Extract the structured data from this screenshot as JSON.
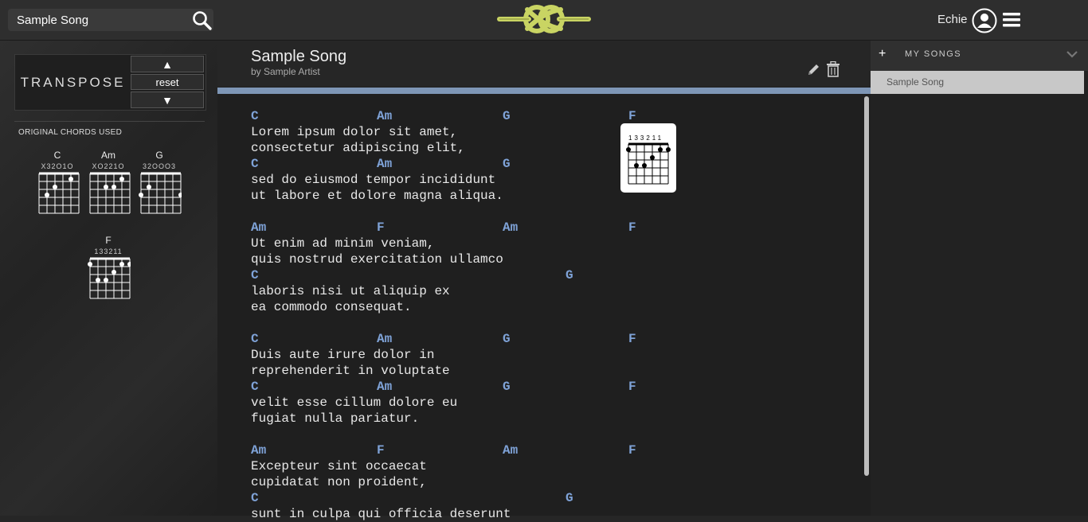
{
  "header": {
    "search_value": "Sample Song",
    "username": "Echie"
  },
  "transpose": {
    "label": "TRANSPOSE",
    "up": "▲",
    "reset": "reset",
    "down": "▼"
  },
  "original_chords": {
    "label": "ORIGINAL CHORDS USED",
    "chords": [
      {
        "name": "C",
        "fingering": "X32O1O"
      },
      {
        "name": "Am",
        "fingering": "XO221O"
      },
      {
        "name": "G",
        "fingering": "32OOO3"
      },
      {
        "name": "F",
        "fingering": "133211"
      }
    ]
  },
  "song": {
    "title": "Sample Song",
    "artist": "by Sample Artist",
    "popup_fingering": "133211",
    "lines": [
      {
        "chords": [
          {
            "c": "C",
            "p": 0
          },
          {
            "c": "Am",
            "p": 16
          },
          {
            "c": "G",
            "p": 32
          },
          {
            "c": "F",
            "p": 48
          }
        ]
      },
      {
        "lyric": "Lorem ipsum dolor sit amet,"
      },
      {
        "lyric": "consectetur adipiscing elit,"
      },
      {
        "chords": [
          {
            "c": "C",
            "p": 0
          },
          {
            "c": "Am",
            "p": 16
          },
          {
            "c": "G",
            "p": 32
          }
        ]
      },
      {
        "lyric": "sed do eiusmod tempor incididunt"
      },
      {
        "lyric": "ut labore et dolore magna aliqua."
      },
      {
        "gap": true
      },
      {
        "chords": [
          {
            "c": "Am",
            "p": 0
          },
          {
            "c": "F",
            "p": 16
          },
          {
            "c": "Am",
            "p": 32
          },
          {
            "c": "F",
            "p": 48
          }
        ]
      },
      {
        "lyric": "Ut enim ad minim veniam,"
      },
      {
        "lyric": "quis nostrud exercitation ullamco"
      },
      {
        "chords": [
          {
            "c": "C",
            "p": 0
          },
          {
            "c": "G",
            "p": 40
          }
        ]
      },
      {
        "lyric": "laboris nisi ut aliquip ex"
      },
      {
        "lyric": "ea commodo consequat."
      },
      {
        "gap": true
      },
      {
        "chords": [
          {
            "c": "C",
            "p": 0
          },
          {
            "c": "Am",
            "p": 16
          },
          {
            "c": "G",
            "p": 32
          },
          {
            "c": "F",
            "p": 48
          }
        ]
      },
      {
        "lyric": "Duis aute irure dolor in"
      },
      {
        "lyric": "reprehenderit in voluptate"
      },
      {
        "chords": [
          {
            "c": "C",
            "p": 0
          },
          {
            "c": "Am",
            "p": 16
          },
          {
            "c": "G",
            "p": 32
          },
          {
            "c": "F",
            "p": 48
          }
        ]
      },
      {
        "lyric": "velit esse cillum dolore eu"
      },
      {
        "lyric": "fugiat nulla pariatur."
      },
      {
        "gap": true
      },
      {
        "chords": [
          {
            "c": "Am",
            "p": 0
          },
          {
            "c": "F",
            "p": 16
          },
          {
            "c": "Am",
            "p": 32
          },
          {
            "c": "F",
            "p": 48
          }
        ]
      },
      {
        "lyric": "Excepteur sint occaecat"
      },
      {
        "lyric": "cupidatat non proident,"
      },
      {
        "chords": [
          {
            "c": "C",
            "p": 0
          },
          {
            "c": "G",
            "p": 40
          }
        ]
      },
      {
        "lyric": "sunt in culpa qui officia deserunt"
      }
    ]
  },
  "sidebar": {
    "plus": "+",
    "title": "MY SONGS",
    "items": [
      "Sample Song"
    ]
  },
  "colors": {
    "chord": "#7fa3d8",
    "accent_bar": "#7e96b6",
    "logo": "#c9d463"
  }
}
